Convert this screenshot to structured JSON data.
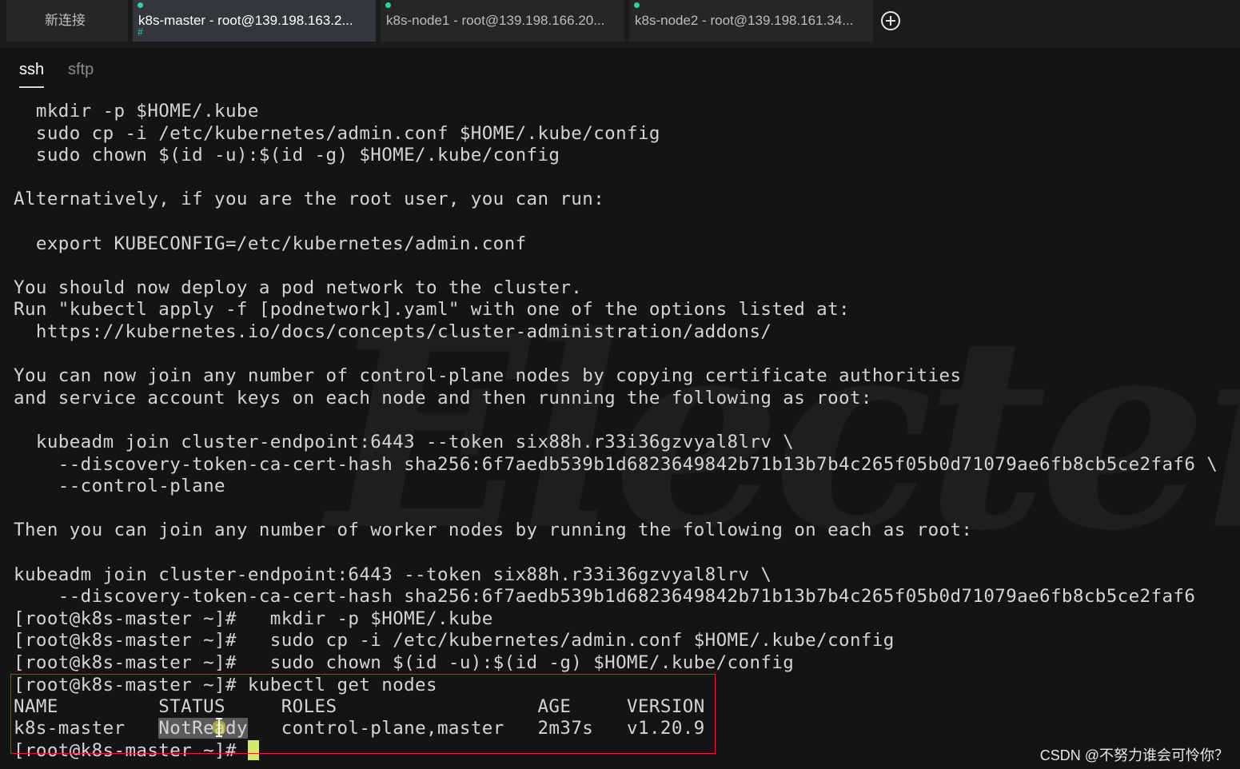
{
  "tabs": [
    {
      "label": "新连接",
      "status": ""
    },
    {
      "label": "k8s-master - root@139.198.163.2...",
      "status": "connected"
    },
    {
      "label": "k8s-node1 - root@139.198.166.20...",
      "status": "connected"
    },
    {
      "label": "k8s-node2 - root@139.198.161.34...",
      "status": "connected"
    }
  ],
  "subtabs": {
    "ssh": "ssh",
    "sftp": "sftp"
  },
  "terminal": {
    "lines": [
      "  mkdir -p $HOME/.kube",
      "  sudo cp -i /etc/kubernetes/admin.conf $HOME/.kube/config",
      "  sudo chown $(id -u):$(id -g) $HOME/.kube/config",
      "",
      "Alternatively, if you are the root user, you can run:",
      "",
      "  export KUBECONFIG=/etc/kubernetes/admin.conf",
      "",
      "You should now deploy a pod network to the cluster.",
      "Run \"kubectl apply -f [podnetwork].yaml\" with one of the options listed at:",
      "  https://kubernetes.io/docs/concepts/cluster-administration/addons/",
      "",
      "You can now join any number of control-plane nodes by copying certificate authorities",
      "and service account keys on each node and then running the following as root:",
      "",
      "  kubeadm join cluster-endpoint:6443 --token six88h.r33i36gzvyal8lrv \\",
      "    --discovery-token-ca-cert-hash sha256:6f7aedb539b1d6823649842b71b13b7b4c265f05b0d71079ae6fb8cb5ce2faf6 \\",
      "    --control-plane",
      "",
      "Then you can join any number of worker nodes by running the following on each as root:",
      "",
      "kubeadm join cluster-endpoint:6443 --token six88h.r33i36gzvyal8lrv \\",
      "    --discovery-token-ca-cert-hash sha256:6f7aedb539b1d6823649842b71b13b7b4c265f05b0d71079ae6fb8cb5ce2faf6",
      "[root@k8s-master ~]#   mkdir -p $HOME/.kube",
      "[root@k8s-master ~]#   sudo cp -i /etc/kubernetes/admin.conf $HOME/.kube/config",
      "[root@k8s-master ~]#   sudo chown $(id -u):$(id -g) $HOME/.kube/config",
      "[root@k8s-master ~]# kubectl get nodes",
      "NAME         STATUS     ROLES                  AGE     VERSION"
    ],
    "node_row": {
      "name": "k8s-master   ",
      "status": "NotReady",
      "rest": "   control-plane,master   2m37s   v1.20.9"
    },
    "prompt": "[root@k8s-master ~]# "
  },
  "watermark": "Electerm",
  "csdn_credit": "CSDN @不努力谁会可怜你？",
  "colors": {
    "accent": "#2fd1a4",
    "highlight_border": "#e0202a",
    "cursor": "#d6e86b"
  }
}
